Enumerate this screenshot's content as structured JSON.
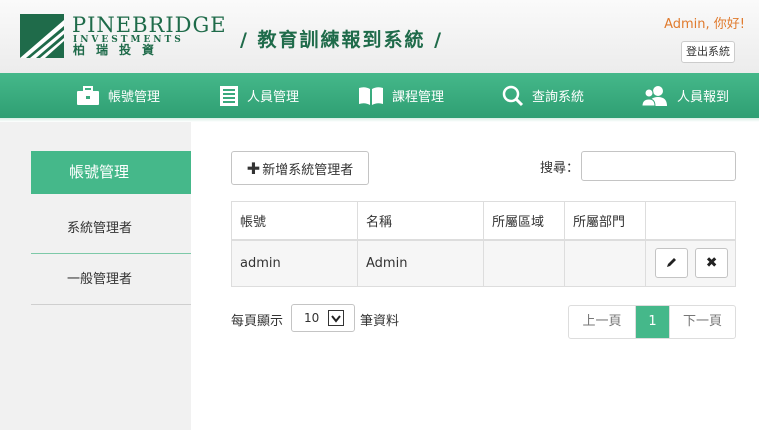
{
  "header": {
    "logo_brand": "PINEBRIDGE",
    "logo_sub": "INVESTMENTS",
    "logo_cn": "柏瑞投資",
    "system_title": "/ 教育訓練報到系統 /",
    "greeting": "Admin, 你好!",
    "logout_label": "登出系統",
    "brand_color": "#1f6b4a",
    "accent_color": "#e07b2e"
  },
  "nav": {
    "items": [
      {
        "label": "帳號管理",
        "icon": "briefcase-icon"
      },
      {
        "label": "人員管理",
        "icon": "list-icon"
      },
      {
        "label": "課程管理",
        "icon": "book-icon"
      },
      {
        "label": "查詢系統",
        "icon": "search-icon"
      },
      {
        "label": "人員報到",
        "icon": "users-icon"
      }
    ],
    "color": "#45b88a"
  },
  "sidebar": {
    "active_label": "帳號管理",
    "items": [
      {
        "label": "系統管理者"
      },
      {
        "label": "一般管理者"
      }
    ]
  },
  "main": {
    "add_button_label": "新增系統管理者",
    "search_label": "搜尋：",
    "search_value": "",
    "table": {
      "columns": [
        "帳號",
        "名稱",
        "所屬區域",
        "所屬部門",
        ""
      ],
      "rows": [
        {
          "account": "admin",
          "name": "Admin",
          "region": "",
          "department": ""
        }
      ]
    },
    "page_size_label": "每頁顯示",
    "page_size_value": "10",
    "page_size_suffix": "筆資料",
    "pager": {
      "prev_label": "上一頁",
      "current_page": "1",
      "next_label": "下一頁"
    }
  }
}
